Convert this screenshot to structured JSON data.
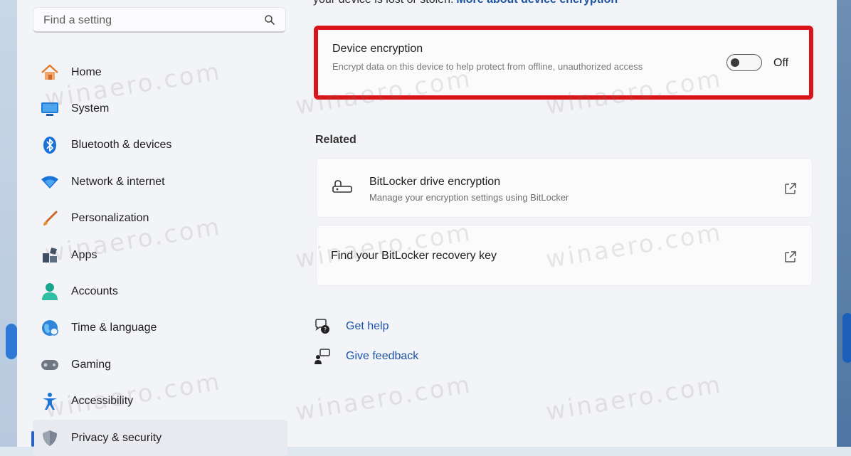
{
  "top_text": {
    "prefix": "your device is lost or stolen.",
    "link": "More about device encryption"
  },
  "search": {
    "placeholder": "Find a setting"
  },
  "nav": {
    "items": [
      {
        "label": "Home",
        "icon": "home-icon"
      },
      {
        "label": "System",
        "icon": "system-icon"
      },
      {
        "label": "Bluetooth & devices",
        "icon": "bluetooth-icon"
      },
      {
        "label": "Network & internet",
        "icon": "wifi-icon"
      },
      {
        "label": "Personalization",
        "icon": "brush-icon"
      },
      {
        "label": "Apps",
        "icon": "apps-icon"
      },
      {
        "label": "Accounts",
        "icon": "accounts-icon"
      },
      {
        "label": "Time & language",
        "icon": "globe-icon"
      },
      {
        "label": "Gaming",
        "icon": "gamepad-icon"
      },
      {
        "label": "Accessibility",
        "icon": "accessibility-icon"
      },
      {
        "label": "Privacy & security",
        "icon": "shield-icon",
        "active": true
      }
    ]
  },
  "device_encryption": {
    "title": "Device encryption",
    "description": "Encrypt data on this device to help protect from offline, unauthorized access",
    "state_label": "Off",
    "enabled": false
  },
  "related": {
    "heading": "Related",
    "bitlocker": {
      "title": "BitLocker drive encryption",
      "subtitle": "Manage your encryption settings using BitLocker"
    },
    "recovery_key": {
      "title": "Find your BitLocker recovery key"
    }
  },
  "help": {
    "get_help": "Get help",
    "give_feedback": "Give feedback"
  },
  "watermark": "winaero.com",
  "colors": {
    "accent": "#2863c4",
    "link": "#1c53a4",
    "highlight_border": "#d9151b"
  }
}
